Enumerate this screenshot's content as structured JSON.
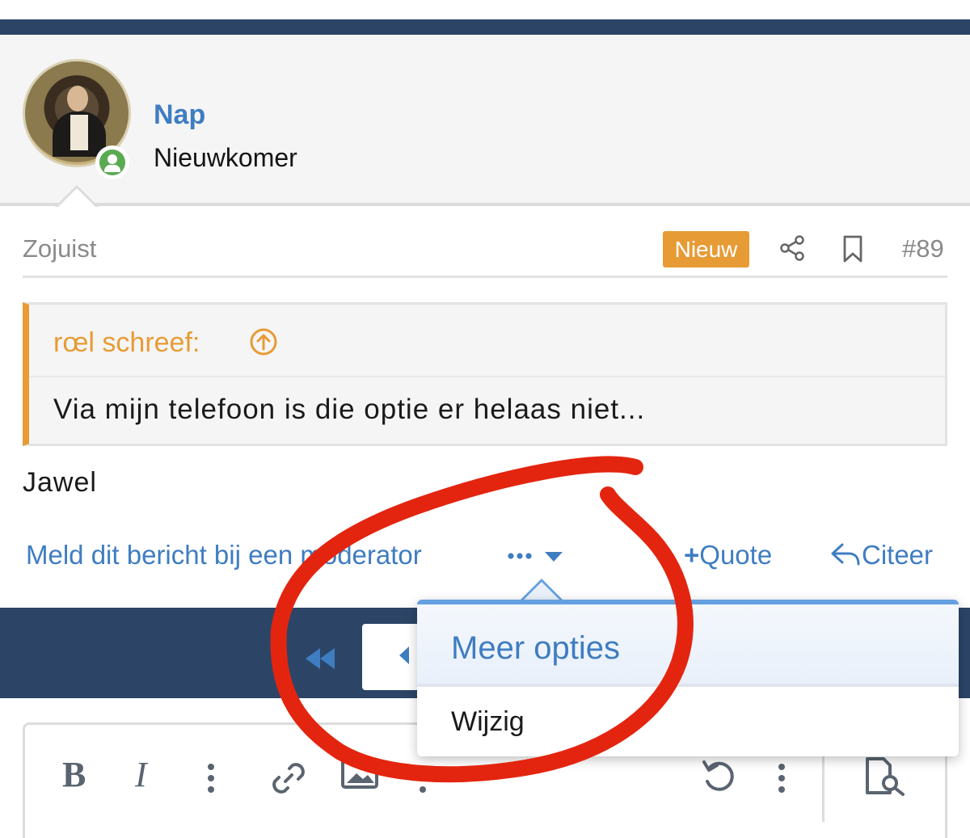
{
  "user": {
    "name": "Nap",
    "title": "Nieuwkomer",
    "status_color": "#5aaa52"
  },
  "post": {
    "timestamp": "Zojuist",
    "new_badge": "Nieuw",
    "number": "#89",
    "quote": {
      "author_line": "rœl schreef:",
      "text": "Via mijn telefoon is die optie er helaas niet..."
    },
    "body": "Jawel",
    "actions": {
      "report": "Meld dit bericht bij een moderator",
      "more": "•••",
      "quote_label": "Quote",
      "reply_label": "Citeer"
    }
  },
  "dropdown": {
    "title": "Meer opties",
    "items": [
      "Wijzig"
    ]
  },
  "editor": {
    "bold": "B",
    "italic": "I"
  },
  "colors": {
    "accent": "#3f7dc1",
    "nav": "#2c4567",
    "badge": "#e79b35",
    "annotation": "#e3250f"
  }
}
